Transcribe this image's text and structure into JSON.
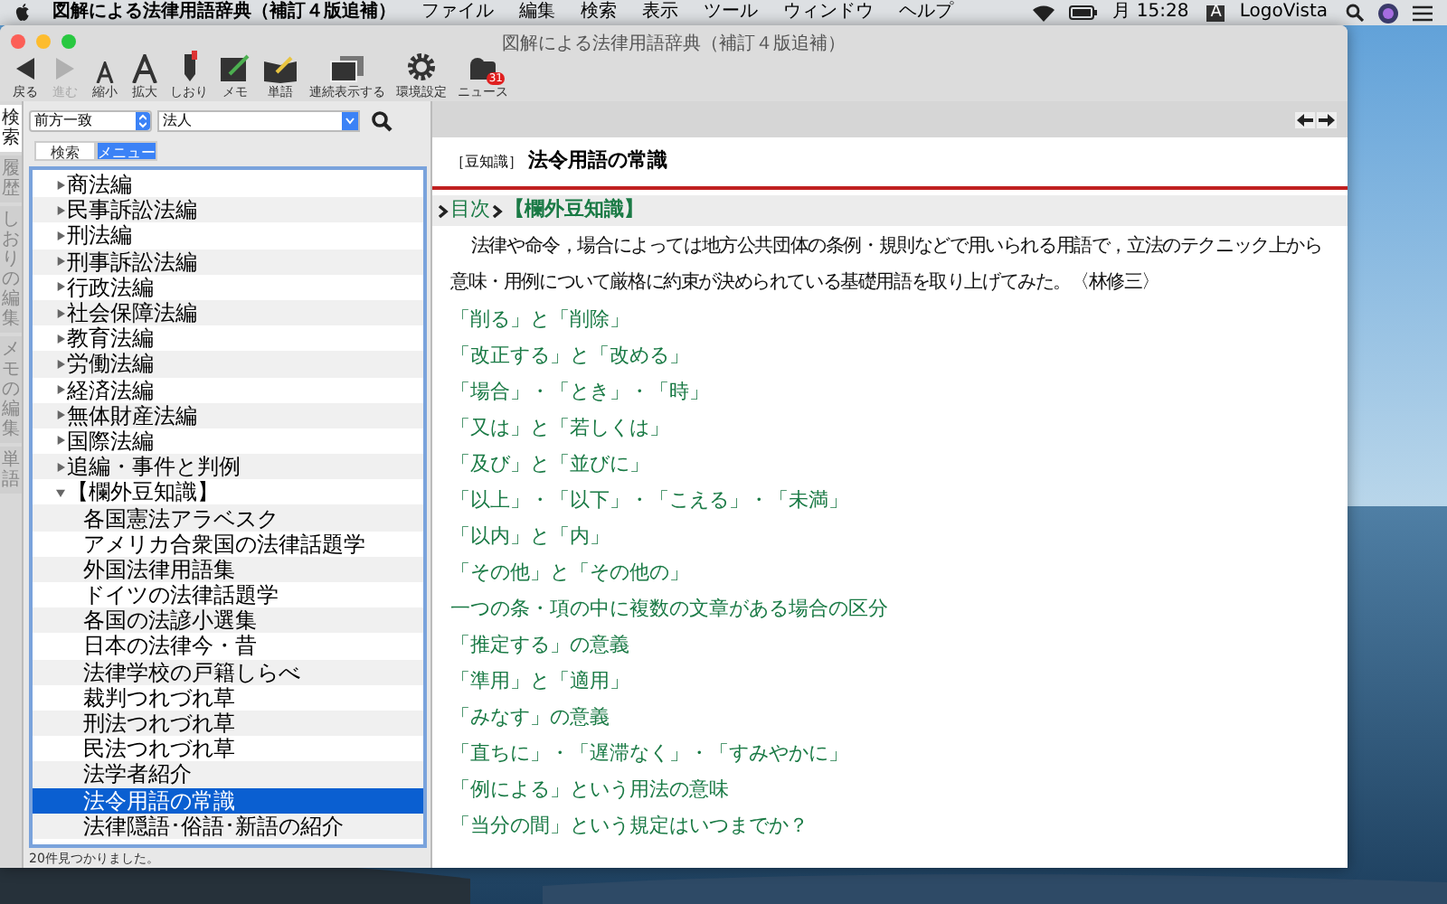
{
  "menu_bar": {
    "app_name": "図解による法律用語辞典（補訂４版追補）",
    "menus": [
      "ファイル",
      "編集",
      "検索",
      "表示",
      "ツール",
      "ウィンドウ",
      "ヘルプ"
    ],
    "clock": "月 15:28",
    "input_indicator": "A",
    "user": "LogoVista"
  },
  "window": {
    "title": "図解による法律用語辞典（補訂４版追補）"
  },
  "toolbar": [
    {
      "kind": "back",
      "label": "戻る",
      "disabled": false
    },
    {
      "kind": "forward",
      "label": "進む",
      "disabled": true
    },
    {
      "kind": "smaller",
      "label": "縮小",
      "disabled": false
    },
    {
      "kind": "larger",
      "label": "拡大",
      "disabled": false
    },
    {
      "kind": "bookmark",
      "label": "しおり",
      "disabled": false
    },
    {
      "kind": "memo",
      "label": "メモ",
      "disabled": false
    },
    {
      "kind": "word",
      "label": "単語",
      "disabled": false
    },
    {
      "kind": "continuous",
      "label": "連続表示する",
      "disabled": false
    },
    {
      "kind": "settings",
      "label": "環境設定",
      "disabled": false
    },
    {
      "kind": "news",
      "label": "ニュース",
      "badge": "31",
      "disabled": false
    }
  ],
  "side_tabs": [
    {
      "label": "検索",
      "selected": true
    },
    {
      "label": "履歴",
      "selected": false
    },
    {
      "label": "しおりの編集",
      "selected": false
    },
    {
      "label": "メモの編集",
      "selected": false
    },
    {
      "label": "単語",
      "selected": false
    }
  ],
  "search": {
    "mode": "前方一致",
    "value": "法人"
  },
  "segments": [
    {
      "label": "検索",
      "selected": false
    },
    {
      "label": "メニュー",
      "selected": true
    }
  ],
  "tree": [
    {
      "label": "商法編",
      "expanded": false,
      "selected": false
    },
    {
      "label": "民事訴訟法編",
      "expanded": false,
      "selected": false
    },
    {
      "label": "刑法編",
      "expanded": false,
      "selected": false
    },
    {
      "label": "刑事訴訟法編",
      "expanded": false,
      "selected": false
    },
    {
      "label": "行政法編",
      "expanded": false,
      "selected": false
    },
    {
      "label": "社会保障法編",
      "expanded": false,
      "selected": false
    },
    {
      "label": "教育法編",
      "expanded": false,
      "selected": false
    },
    {
      "label": "労働法編",
      "expanded": false,
      "selected": false
    },
    {
      "label": "経済法編",
      "expanded": false,
      "selected": false
    },
    {
      "label": "無体財産法編",
      "expanded": false,
      "selected": false
    },
    {
      "label": "国際法編",
      "expanded": false,
      "selected": false
    },
    {
      "label": "追編・事件と判例",
      "expanded": false,
      "selected": false
    },
    {
      "label": "【欄外豆知識】",
      "expanded": true,
      "selected": false,
      "children": [
        {
          "label": "各国憲法アラベスク",
          "selected": false
        },
        {
          "label": "アメリカ合衆国の法律話題学",
          "selected": false
        },
        {
          "label": "外国法律用語集",
          "selected": false
        },
        {
          "label": "ドイツの法律話題学",
          "selected": false
        },
        {
          "label": "各国の法諺小選集",
          "selected": false
        },
        {
          "label": "日本の法律今・昔",
          "selected": false
        },
        {
          "label": "法律学校の戸籍しらべ",
          "selected": false
        },
        {
          "label": "裁判つれづれ草",
          "selected": false
        },
        {
          "label": "刑法つれづれ草",
          "selected": false
        },
        {
          "label": "民法つれづれ草",
          "selected": false
        },
        {
          "label": "法学者紹介",
          "selected": false
        },
        {
          "label": "法令用語の常識",
          "selected": true
        },
        {
          "label": "法律隠語･俗語･新語の紹介",
          "selected": false
        }
      ]
    }
  ],
  "status": "20件見つかりました。",
  "article": {
    "tag": "［豆知識］",
    "title": "法令用語の常識",
    "breadcrumb": [
      "目次",
      "【欄外豆知識】"
    ],
    "intro": "法律や命令，場合によっては地方公共団体の条例・規則などで用いられる用語で，立法のテクニック上から意味・用例について厳格に約束が決められている基礎用語を取り上げてみた。〈林修三〉",
    "links": [
      "「削る」と「削除」",
      "「改正する」と「改める」",
      "「場合」・「とき」・「時」",
      "「又は」と「若しくは」",
      "「及び」と「並びに」",
      "「以上」・「以下」・「こえる」・「未満」",
      "「以内」と「内」",
      "「その他」と「その他の」",
      "一つの条・項の中に複数の文章がある場合の区分",
      "「推定する」の意義",
      "「準用」と「適用」",
      "「みなす」の意義",
      "「直ちに」・「遅滞なく」・「すみやかに」",
      "「例による」という用法の意味",
      "「当分の間」という規定はいつまでか？"
    ]
  }
}
